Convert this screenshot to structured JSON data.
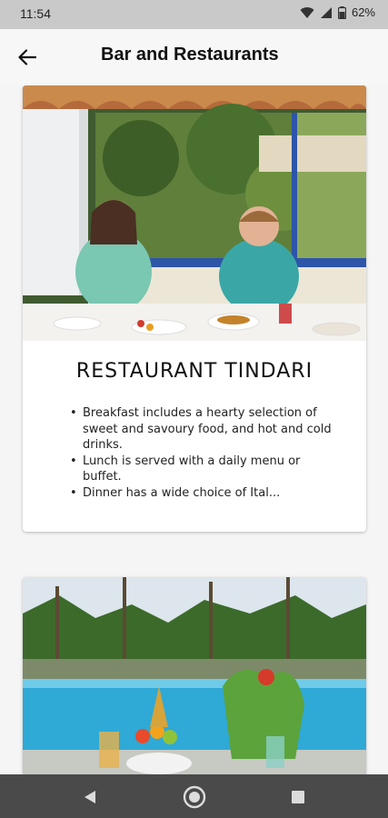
{
  "status_bar": {
    "time": "11:54",
    "battery": "62%",
    "icons": [
      "wifi-icon",
      "signal-icon",
      "battery-icon"
    ]
  },
  "app_bar": {
    "back_icon": "arrow-left-icon",
    "title": "Bar and Restaurants"
  },
  "cards": [
    {
      "title": "RESTAURANT TINDARI",
      "items": [
        "Breakfast includes a hearty selection of sweet and savoury food, and hot and cold drinks.",
        "Lunch is served with a daily menu or buffet.",
        "Dinner has a wide choice of Ital..."
      ]
    },
    {
      "title": "",
      "items": []
    }
  ],
  "nav_bar": {
    "icons": [
      "back-triangle-icon",
      "home-circle-icon",
      "recents-square-icon"
    ]
  },
  "colors": {
    "status_bar": "#c9c9c9",
    "app_bar": "#f7f7f7",
    "background": "#f5f5f5",
    "nav_bar": "#4a4a4a"
  }
}
